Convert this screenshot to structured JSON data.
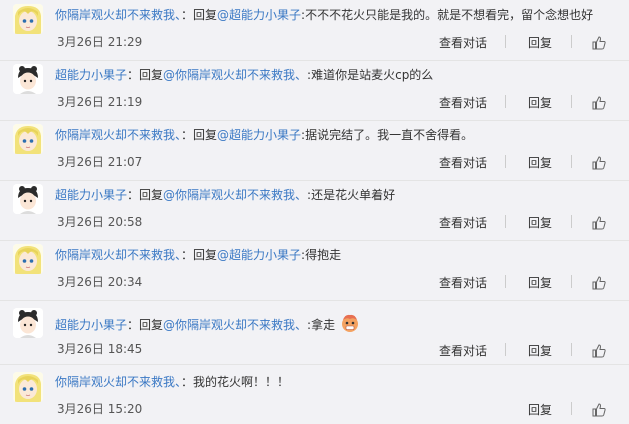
{
  "comments": [
    {
      "avatar": "yellow-hair-anime-avatar",
      "user": "你隔岸观火却不来救我、",
      "sep": "：回复",
      "mention": "@超能力小果子",
      "text": ":不不不花火只能是我的。就是不想看完，留个念想也好",
      "time": "3月26日 21:29",
      "talk": "查看对话",
      "reply": "回复"
    },
    {
      "avatar": "dark-hair-anime-avatar",
      "user": "超能力小果子",
      "sep": "：回复",
      "mention": "@你隔岸观火却不来救我、",
      "text": ":难道你是站麦火cp的么",
      "time": "3月26日 21:19",
      "talk": "查看对话",
      "reply": "回复"
    },
    {
      "avatar": "yellow-hair-anime-avatar",
      "user": "你隔岸观火却不来救我、",
      "sep": "：回复",
      "mention": "@超能力小果子",
      "text": ":据说完结了。我一直不舍得看。",
      "time": "3月26日 21:07",
      "talk": "查看对话",
      "reply": "回复"
    },
    {
      "avatar": "dark-hair-anime-avatar",
      "user": "超能力小果子",
      "sep": "：回复",
      "mention": "@你隔岸观火却不来救我、",
      "text": ":还是花火单着好",
      "time": "3月26日 20:58",
      "talk": "查看对话",
      "reply": "回复"
    },
    {
      "avatar": "yellow-hair-anime-avatar",
      "user": "你隔岸观火却不来救我、",
      "sep": "：回复",
      "mention": "@超能力小果子",
      "text": ":得抱走",
      "time": "3月26日 20:34",
      "talk": "查看对话",
      "reply": "回复"
    },
    {
      "avatar": "dark-hair-anime-avatar",
      "user": "超能力小果子",
      "sep": "：回复",
      "mention": "@你隔岸观火却不来救我、",
      "text": ":拿走",
      "emoji": "cartoon-face-emoji",
      "time": "3月26日 18:45",
      "talk": "查看对话",
      "reply": "回复"
    },
    {
      "avatar": "yellow-hair-anime-avatar",
      "user": "你隔岸观火却不来救我、",
      "sep": "：我的花火啊！！！",
      "mention": "",
      "text": "",
      "time": "3月26日 15:20",
      "reply": "回复"
    }
  ],
  "colors": {
    "background": "#f2f2f5",
    "link": "#3a78c4",
    "text": "#333333"
  }
}
